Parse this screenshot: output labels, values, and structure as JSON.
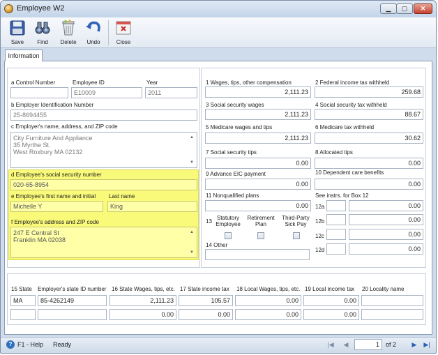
{
  "window": {
    "title": "Employee W2"
  },
  "toolbar": [
    {
      "id": "save",
      "label": "Save",
      "icon": "save-icon"
    },
    {
      "id": "find",
      "label": "Find",
      "icon": "binoculars-icon"
    },
    {
      "id": "delete",
      "label": "Delete",
      "icon": "trash-icon"
    },
    {
      "id": "undo",
      "label": "Undo",
      "icon": "undo-icon"
    },
    {
      "id": "close",
      "label": "Close",
      "icon": "close-form-icon"
    }
  ],
  "tabs": [
    {
      "label": "Information",
      "active": true
    }
  ],
  "left": {
    "a_label": "a  Control Number",
    "a_value": "",
    "employee_id_label": "Employee ID",
    "employee_id": "E10009",
    "year_label": "Year",
    "year": "2011",
    "b_label": "b  Employer Identification Number",
    "b_value": "25-8694455",
    "c_label": "c  Employer's name, address, and ZIP code",
    "c_lines": [
      "City Furniture And Appliance",
      "35 Myrthe St.",
      "West Roxbury MA 02132"
    ],
    "d_label": "d  Employee's social security number",
    "d_value": "020-65-8954",
    "e_label": "e  Employee's first name and initial",
    "e_value": "Michelle Y",
    "last_name_label": "Last name",
    "last_name": "King",
    "f_label": "f  Employee's address and ZIP code",
    "f_lines": [
      "247 E Central St",
      "Franklin MA 02038"
    ]
  },
  "right": {
    "box1_label": "1  Wages, tips, other compensation",
    "box1": "2,111.23",
    "box2_label": "2  Federal income tax withheld",
    "box2": "259.68",
    "box3_label": "3  Social security wages",
    "box3": "2,111.23",
    "box4_label": "4  Social security tax withheld",
    "box4": "88.67",
    "box5_label": "5  Medicare wages and tips",
    "box5": "2,111.23",
    "box6_label": "6  Medicare tax withheld",
    "box6": "30.62",
    "box7_label": "7  Social security tips",
    "box7": "0.00",
    "box8_label": "8  Allocated tips",
    "box8": "0.00",
    "box9_label": "9  Advance EIC payment",
    "box9": "0.00",
    "box10_label": "10  Dependent care benefits",
    "box10": "0.00",
    "box11_label": "11  Nonqualified plans",
    "box11": "0.00",
    "box12_header": "See instrs. for Box 12",
    "box12": [
      {
        "code_label": "12a",
        "code": "",
        "amount": "0.00"
      },
      {
        "code_label": "12b",
        "code": "",
        "amount": "0.00"
      },
      {
        "code_label": "12c",
        "code": "",
        "amount": "0.00"
      },
      {
        "code_label": "12d",
        "code": "",
        "amount": "0.00"
      }
    ],
    "box13_label": "13",
    "box13_checks": [
      {
        "label": "Statutory\nEmployee",
        "checked": false
      },
      {
        "label": "Retirement\nPlan",
        "checked": false
      },
      {
        "label": "Third-Party\nSick Pay",
        "checked": false
      }
    ],
    "box14_label": "14  Other",
    "box14": ""
  },
  "state": {
    "headers": [
      "15  State",
      "Employer's state ID number",
      "16  State Wages, tips, etc.",
      "17  State income tax",
      "18  Local Wages, tips, etc.",
      "19  Local income tax",
      "20  Locality name"
    ],
    "rows": [
      {
        "state": "MA",
        "id": "85-4262149",
        "wages": "2,111.23",
        "tax": "105.57",
        "local_wages": "0.00",
        "local_tax": "0.00",
        "locality": ""
      },
      {
        "state": "",
        "id": "",
        "wages": "0.00",
        "tax": "0.00",
        "local_wages": "0.00",
        "local_tax": "0.00",
        "locality": ""
      }
    ]
  },
  "status": {
    "help": "F1 - Help",
    "text": "Ready",
    "page": "1",
    "of_label": "of 2"
  }
}
